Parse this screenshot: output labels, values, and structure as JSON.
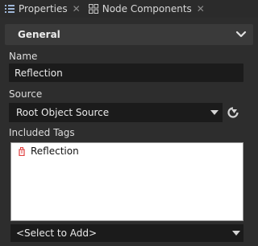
{
  "tabs": [
    {
      "label": "Properties",
      "icon": "list-icon"
    },
    {
      "label": "Node Components",
      "icon": "components-icon"
    }
  ],
  "tab_close_glyph": "✕",
  "section": {
    "title": "General"
  },
  "name": {
    "label": "Name",
    "value": "Reflection"
  },
  "source": {
    "label": "Source",
    "value": "Root Object Source"
  },
  "included_tags": {
    "label": "Included Tags",
    "items": [
      {
        "label": "Reflection",
        "icon": "tag-icon"
      }
    ],
    "add_placeholder": "<Select to Add>"
  },
  "colors": {
    "accent": "#e04040",
    "panel": "#2d2d2d",
    "field": "#1b1b1b"
  }
}
